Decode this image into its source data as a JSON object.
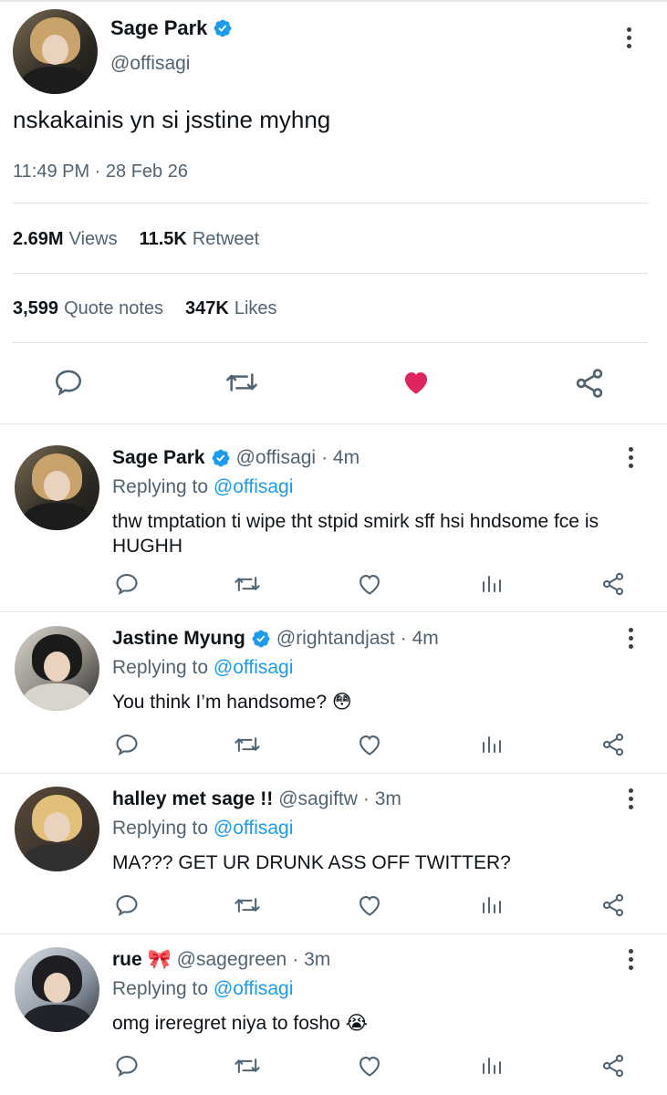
{
  "main_tweet": {
    "name": "Sage Park",
    "handle": "@offisagi",
    "text": "nskakainis yn si jsstine myhng",
    "timestamp": "11:49 PM · 28 Feb 26",
    "stats": {
      "views_count": "2.69M",
      "views_label": "Views",
      "retweet_count": "11.5K",
      "retweet_label": "Retweet",
      "quote_count": "3,599",
      "quote_label": "Quote notes",
      "likes_count": "347K",
      "likes_label": "Likes"
    },
    "liked": true,
    "colors": {
      "like": "#e0245e",
      "verified": "#1d9bf0",
      "link": "#1d9bf0"
    }
  },
  "replies": [
    {
      "name": "Sage Park",
      "verified": true,
      "handle": "@offisagi",
      "time": "· 4m",
      "replying_prefix": "Replying to",
      "replying_to": "@offisagi",
      "text": "thw tmptation ti wipe tht stpid smirk sff hsi hndsome fce is HUGHH"
    },
    {
      "name": "Jastine Myung",
      "verified": true,
      "handle": "@rightandjast",
      "time": "· 4m",
      "replying_prefix": "Replying to",
      "replying_to": "@offisagi",
      "text": "You think I’m handsome? 😳"
    },
    {
      "name": "halley met sage !!",
      "verified": false,
      "handle": "@sagiftw",
      "time": "· 3m",
      "replying_prefix": "Replying to",
      "replying_to": "@offisagi",
      "text": "MA??? GET UR DRUNK ASS OFF TWITTER?"
    },
    {
      "name": "rue 🎀",
      "verified": false,
      "handle": "@sagegreen",
      "time": "· 3m",
      "replying_prefix": "Replying to",
      "replying_to": "@offisagi",
      "text": "omg ireregret niya to fosho 😭"
    }
  ]
}
